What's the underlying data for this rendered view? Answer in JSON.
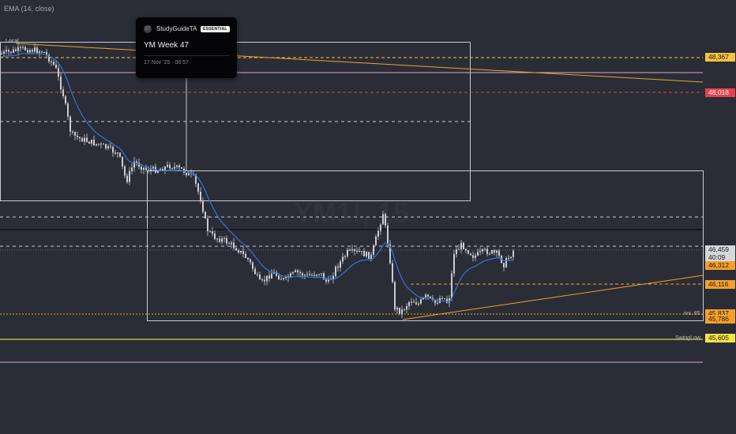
{
  "indicator": "EMA (14, close)",
  "local_label": "Local",
  "idea_card": {
    "avatar": "ST",
    "author": "StudyGuideTA",
    "badge": "ESSENTIAL",
    "title": "YM Week 47",
    "date": "17 Nov '25 · 06:57"
  },
  "watermark": "YM1!, 15",
  "price_tags": [
    {
      "name": "price-tag-48367",
      "label": "48,367",
      "value": 48367,
      "bg": "#f6c343",
      "fg": "#1a1a1a"
    },
    {
      "name": "price-tag-48018",
      "label": "48,018",
      "value": 48018,
      "bg": "#e5414a",
      "fg": "#ffffff"
    },
    {
      "name": "price-tag-46459",
      "label": "46,459",
      "value": 46459,
      "bg": "#d6d8dd",
      "fg": "#1a1a1a"
    },
    {
      "name": "price-tag-countdown",
      "label": "40:09",
      "value": null,
      "bg": "#d6d8dd",
      "fg": "#1a1a1a"
    },
    {
      "name": "price-tag-46312",
      "label": "46,312",
      "value": 46312,
      "bg": "#f6a02b",
      "fg": "#1a1a1a"
    },
    {
      "name": "price-tag-46116",
      "label": "46,116",
      "value": 46116,
      "bg": "#f6a02b",
      "fg": "#1a1a1a"
    },
    {
      "name": "price-tag-45837",
      "label": "45,837",
      "value": 45837,
      "bg": "#f6a02b",
      "fg": "#1a1a1a"
    },
    {
      "name": "price-tag-45786",
      "label": "45,786",
      "value": 45786,
      "bg": "#f6a02b",
      "fg": "#1a1a1a"
    },
    {
      "name": "price-tag-45605",
      "label": "45,605",
      "value": 45605,
      "bg": "#f6e343",
      "fg": "#1a1a1a"
    }
  ],
  "line_labels": {
    "level_85": "ins. 85",
    "swing_low": "SwingLow"
  },
  "colors": {
    "background": "#2a2d36",
    "ema": "#3b6fd4",
    "candle": "#c9ccd4",
    "trendline": "#f0a030",
    "yellow_level": "#e8d040",
    "red_level": "#e5414a"
  }
}
